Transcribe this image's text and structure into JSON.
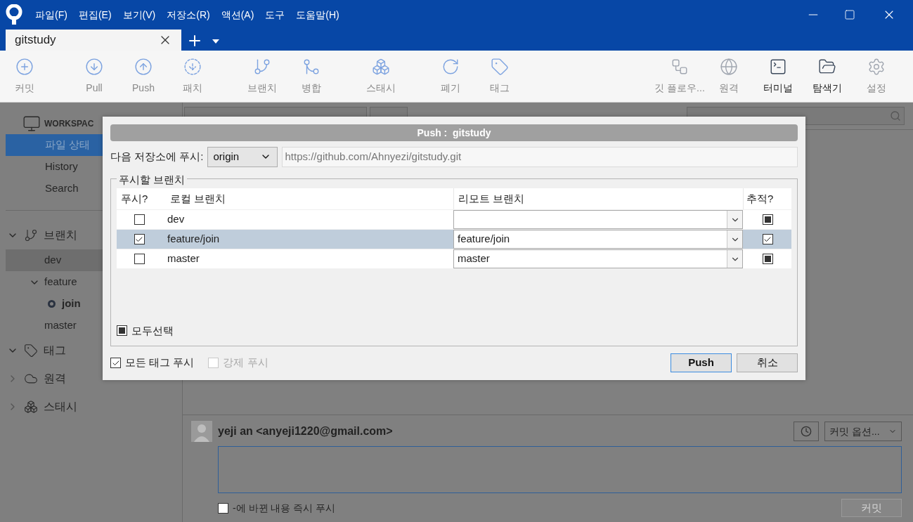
{
  "menu": [
    "파일(F)",
    "편집(E)",
    "보기(V)",
    "저장소(R)",
    "액션(A)",
    "도구",
    "도움말(H)"
  ],
  "tabs": [
    {
      "label": "gitstudy",
      "selected": true
    }
  ],
  "toolbar": {
    "left": [
      [
        {
          "label": "커밋",
          "kind": "commit",
          "strong": false
        }
      ],
      [
        {
          "label": "Pull",
          "kind": "pull",
          "strong": false
        },
        {
          "label": "Push",
          "kind": "push",
          "strong": false
        },
        {
          "label": "패치",
          "kind": "fetch",
          "strong": false
        }
      ],
      [
        {
          "label": "브랜치",
          "kind": "branch",
          "strong": false
        },
        {
          "label": "병합",
          "kind": "merge",
          "strong": false
        }
      ],
      [
        {
          "label": "스태시",
          "kind": "stash",
          "strong": false
        }
      ],
      [
        {
          "label": "폐기",
          "kind": "discard",
          "strong": false
        },
        {
          "label": "태그",
          "kind": "tag",
          "strong": false
        }
      ]
    ],
    "right": [
      {
        "label": "깃 플로우...",
        "kind": "flow",
        "strong": false
      },
      {
        "label": "원격",
        "kind": "remote",
        "strong": false
      },
      {
        "label": "터미널",
        "kind": "terminal",
        "strong": true
      },
      {
        "label": "탐색기",
        "kind": "explorer",
        "strong": true
      },
      {
        "label": "설정",
        "kind": "settings",
        "strong": false
      }
    ]
  },
  "sidebar": {
    "workspace": "WORKSPAC",
    "items": [
      {
        "label": "파일 상태",
        "selected": true
      },
      {
        "label": "History",
        "selected": false
      },
      {
        "label": "Search",
        "selected": false
      }
    ],
    "sections": [
      {
        "label": "브랜치",
        "kind": "branch",
        "expanded": true,
        "children": [
          {
            "label": "dev",
            "selected": true,
            "current": false
          },
          {
            "label": "feature",
            "selected": false,
            "current": false,
            "expanded": true,
            "children": [
              {
                "label": "join",
                "selected": false,
                "current": true
              }
            ]
          },
          {
            "label": "master",
            "selected": false,
            "current": false
          }
        ]
      },
      {
        "label": "태그",
        "kind": "tag",
        "expanded": true
      },
      {
        "label": "원격",
        "kind": "remote",
        "expanded": false
      },
      {
        "label": "스태시",
        "kind": "stash",
        "expanded": false
      }
    ]
  },
  "dialog": {
    "title": "Push :  gitstudy",
    "remote_label": "다음 저장소에 푸시:",
    "remote": "origin",
    "url": "https://github.com/Ahnyezi/gitstudy.git",
    "group_label": "푸시할 브랜치",
    "columns": [
      "푸시?",
      "로컬 브랜치",
      "리모트 브랜치",
      "추적?"
    ],
    "rows": [
      {
        "push": false,
        "local": "dev",
        "tracked": false,
        "selected": false
      },
      {
        "push": true,
        "local": "feature/join",
        "remote": "feature/join",
        "tracked": true,
        "selected": true
      },
      {
        "push": false,
        "local": "master",
        "remote": "master",
        "tracked": false,
        "selected": false
      }
    ],
    "select_all": {
      "label": "모두선택",
      "partial": true
    },
    "options": [
      {
        "label": "모든 태그 푸시",
        "checked": true,
        "disabled": false
      },
      {
        "label": "강제 푸시",
        "checked": false,
        "disabled": true
      }
    ],
    "buttons": [
      {
        "label": "Push",
        "default": true
      },
      {
        "label": "취소",
        "default": false
      }
    ]
  },
  "commit": {
    "author": "yeji an <anyeji1220@gmail.com>",
    "options": "커밋 옵션...",
    "push_now": {
      "label": "-에 바뀐 내용 즉시 푸시",
      "checked": false
    },
    "commit_button": {
      "label": "커밋",
      "disabled": true
    }
  }
}
